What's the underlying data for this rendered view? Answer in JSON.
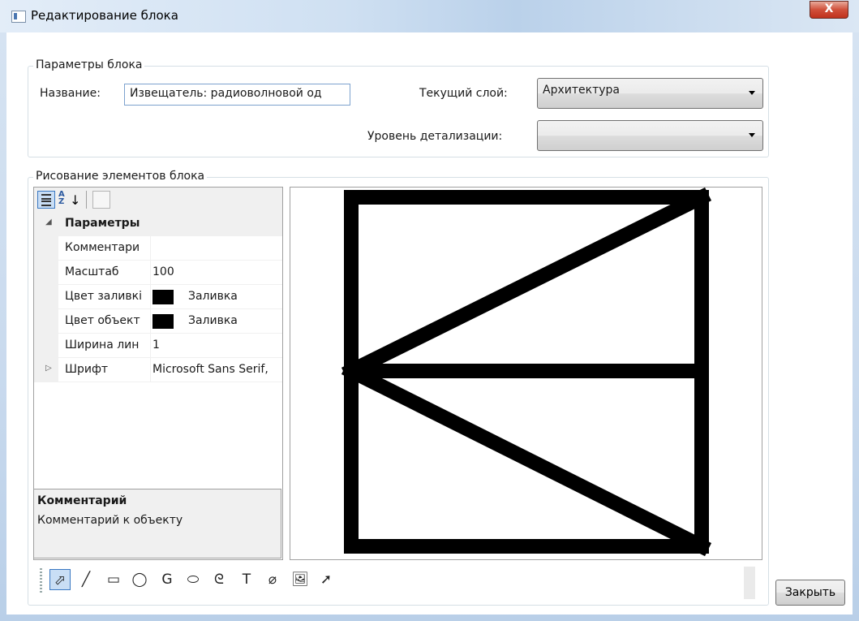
{
  "window": {
    "title": "Редактирование блока",
    "close_glyph": "X"
  },
  "block_params": {
    "group_title": "Параметры блока",
    "name_label": "Название:",
    "name_value": "Извещатель: радиоволновой од",
    "layer_label": "Текущий слой:",
    "layer_value": "Архитектура",
    "detail_label": "Уровень детализации:",
    "detail_value": ""
  },
  "drawing": {
    "group_title": "Рисование элементов блока"
  },
  "property_grid": {
    "category": "Параметры",
    "rows": [
      {
        "name": "Комментари",
        "value": ""
      },
      {
        "name": "Масштаб",
        "value": "100"
      },
      {
        "name": "Цвет заливкі",
        "value": "Заливка",
        "swatch": "#000000"
      },
      {
        "name": "Цвет объект",
        "value": "Заливка",
        "swatch": "#000000"
      },
      {
        "name": "Ширина лин",
        "value": "1"
      },
      {
        "name": "Шрифт",
        "value": "Microsoft Sans Serif,"
      }
    ],
    "description_title": "Комментарий",
    "description_text": "Комментарий к объекту"
  },
  "tools": [
    {
      "name": "select-tool-icon",
      "glyph": "⬀",
      "active": true
    },
    {
      "name": "line-tool-icon",
      "glyph": "╱"
    },
    {
      "name": "rectangle-tool-icon",
      "glyph": "▭"
    },
    {
      "name": "circle-tool-icon",
      "glyph": "◯"
    },
    {
      "name": "arc-tool-icon",
      "glyph": "G"
    },
    {
      "name": "ellipse-tool-icon",
      "glyph": "⬭"
    },
    {
      "name": "curve-tool-icon",
      "glyph": "ᘓ"
    },
    {
      "name": "text-tool-icon",
      "glyph": "T"
    },
    {
      "name": "no-symbol-tool-icon",
      "glyph": "⌀"
    },
    {
      "name": "image-tool-icon",
      "glyph": "🖼"
    },
    {
      "name": "pointer-arrow-tool-icon",
      "glyph": "➚"
    }
  ],
  "buttons": {
    "close": "Закрыть"
  },
  "colors": {
    "accent": "#3a78c2",
    "drawing_stroke": "#000000"
  }
}
